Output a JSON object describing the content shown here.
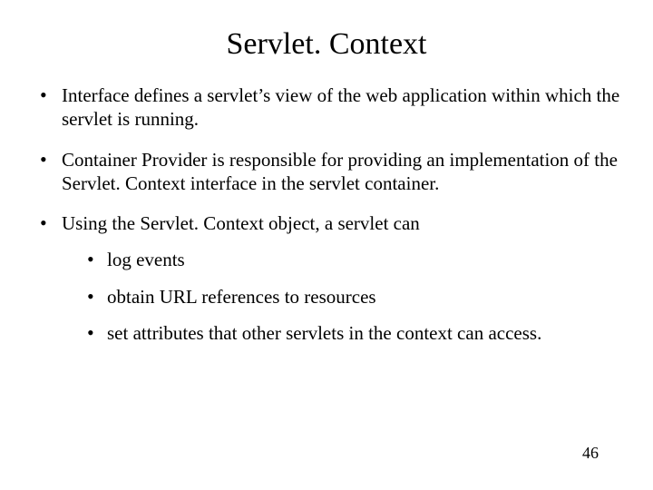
{
  "title": "Servlet. Context",
  "bullets": [
    {
      "text": "Interface defines a servlet’s view of the web application within which the servlet is running."
    },
    {
      "text": "Container Provider is responsible for providing an implementation of the Servlet. Context interface in the servlet container."
    },
    {
      "text": "Using the Servlet. Context object, a servlet can",
      "sub": [
        "log events",
        "obtain URL references to resources",
        "set attributes that other servlets in the context can access."
      ]
    }
  ],
  "page_number": "46"
}
